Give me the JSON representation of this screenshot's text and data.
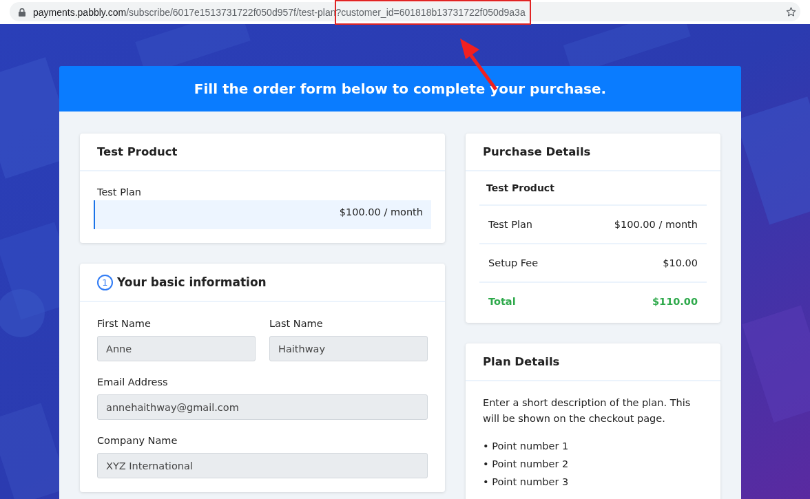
{
  "address_bar": {
    "host": "payments.pabbly.com",
    "path": "/subscribe/6017e1513731722f050d957f/test-plan",
    "query": "?customer_id=601818b13731722f050d9a3a",
    "query_highlighted": true
  },
  "banner": {
    "title": "Fill the order form below to complete your purchase."
  },
  "product_card": {
    "title": "Test Product",
    "plan_label": "Test Plan",
    "plan_price": "$100.00 / month"
  },
  "info_card": {
    "step": "1",
    "title": "Your basic information",
    "fields": [
      {
        "label": "First Name",
        "value": "Anne",
        "half": true
      },
      {
        "label": "Last Name",
        "value": "Haithway",
        "half": true
      },
      {
        "label": "Email Address",
        "value": "annehaithway@gmail.com",
        "half": false
      },
      {
        "label": "Company Name",
        "value": "XYZ International",
        "half": false
      }
    ]
  },
  "purchase_card": {
    "title": "Purchase Details",
    "product": "Test Product",
    "rows": [
      {
        "label": "Test Plan",
        "value": "$100.00 / month",
        "kind": "line"
      },
      {
        "label": "Setup Fee",
        "value": "$10.00",
        "kind": "line"
      },
      {
        "label": "Total",
        "value": "$110.00",
        "kind": "total"
      }
    ]
  },
  "plan_card": {
    "title": "Plan Details",
    "description": "Enter a short description of the plan. This will be shown on the checkout page.",
    "points": [
      "• Point number 1",
      "• Point number 2",
      "• Point number 3"
    ]
  }
}
